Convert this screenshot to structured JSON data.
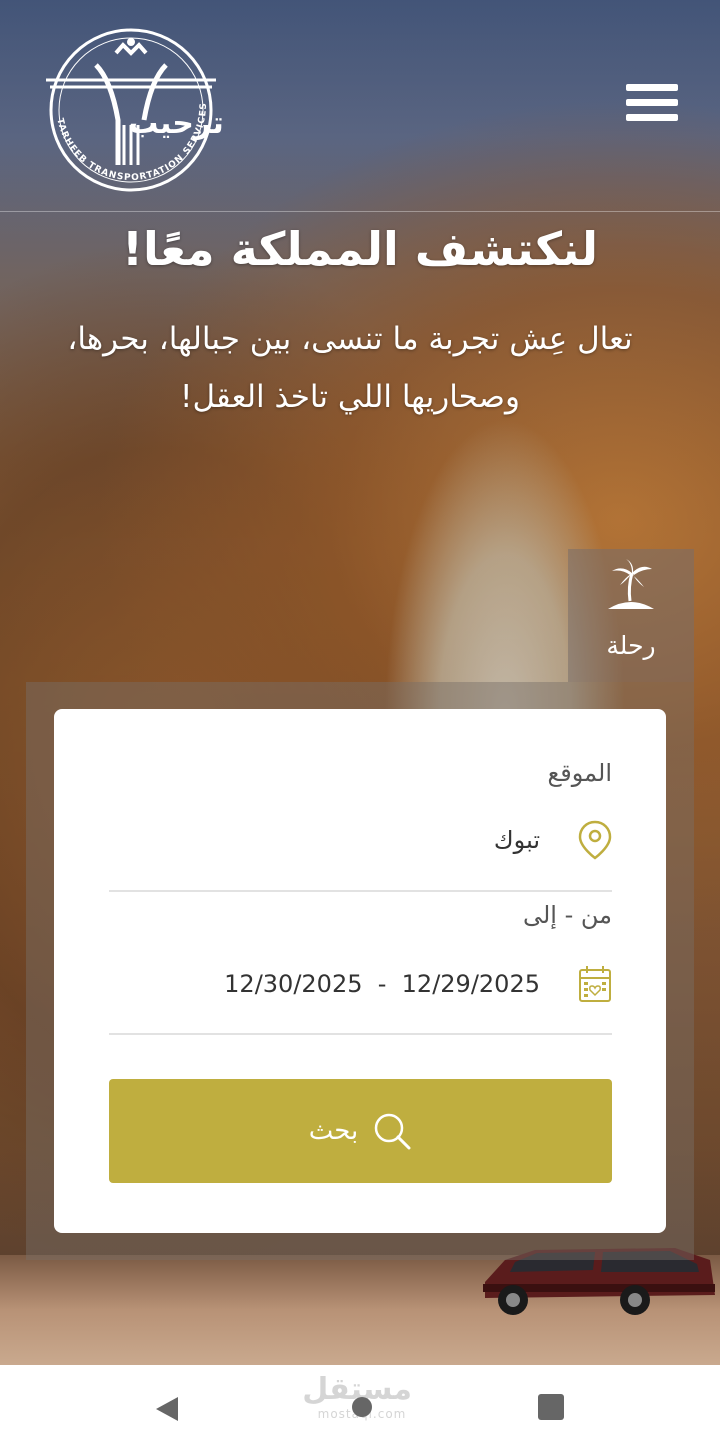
{
  "header": {
    "logo_arabic": "ترحيب",
    "logo_english": "TARHEEB TRANSPORTATION SERVICES"
  },
  "hero": {
    "headline": "لنكتشف المملكة معًا!",
    "subline_1": "تعال عِش تجربة ما تنسى، بين جبالها، بحرها،",
    "subline_2": "وصحاريها اللي تاخذ العقل!"
  },
  "tabs": [
    {
      "label": "رحلة",
      "icon": "palm-island-icon"
    }
  ],
  "search_form": {
    "location_label": "الموقع",
    "location_value": "تبوك",
    "location_icon": "map-pin-icon",
    "dates_label": "من - إلى",
    "date_range": "12/30/2025  -  12/29/2025",
    "calendar_icon": "calendar-icon",
    "search_label": "بحث",
    "search_icon": "search-icon",
    "accent_color": "#bfae3f"
  },
  "watermark": {
    "arabic": "مستقل",
    "latin": "mostaql.com"
  },
  "navbar": {
    "back_icon": "back-triangle-icon",
    "home_icon": "home-circle-icon",
    "recent_icon": "recent-square-icon"
  }
}
